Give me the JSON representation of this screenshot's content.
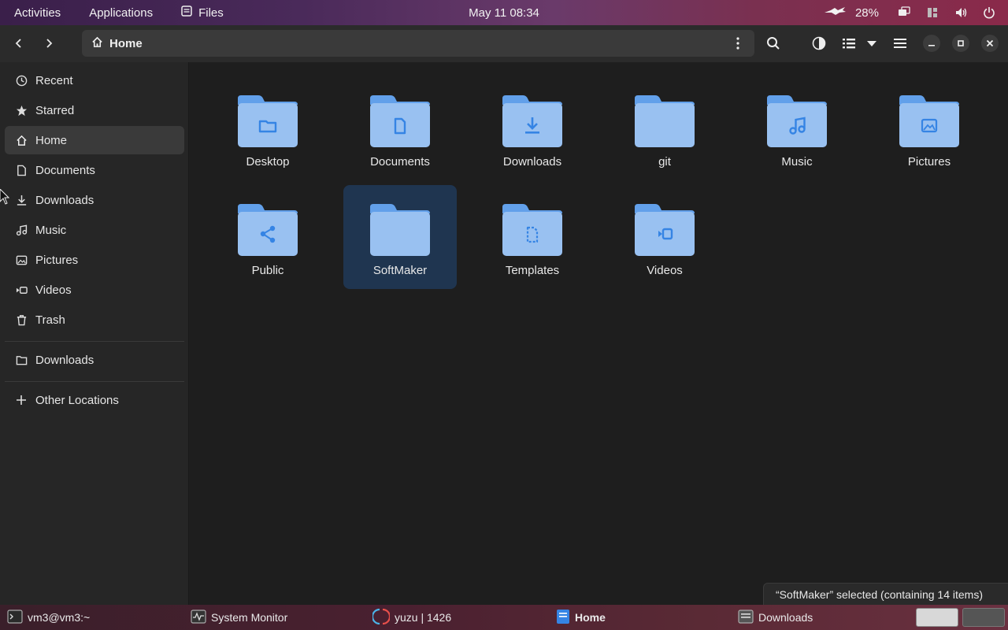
{
  "topbar": {
    "activities": "Activities",
    "applications": "Applications",
    "files": "Files",
    "clock": "May 11  08:34",
    "battery": "28%"
  },
  "header": {
    "path_label": "Home"
  },
  "sidebar": {
    "items": [
      {
        "label": "Recent",
        "icon": "clock-icon"
      },
      {
        "label": "Starred",
        "icon": "star-icon"
      },
      {
        "label": "Home",
        "icon": "home-icon"
      },
      {
        "label": "Documents",
        "icon": "document-icon"
      },
      {
        "label": "Downloads",
        "icon": "download-icon"
      },
      {
        "label": "Music",
        "icon": "music-icon"
      },
      {
        "label": "Pictures",
        "icon": "picture-icon"
      },
      {
        "label": "Videos",
        "icon": "video-icon"
      },
      {
        "label": "Trash",
        "icon": "trash-icon"
      }
    ],
    "bookmarks": [
      {
        "label": "Downloads",
        "icon": "folder-icon"
      }
    ],
    "other_locations": "Other Locations"
  },
  "folders": [
    {
      "name": "Desktop",
      "icon": "desktop-emblem"
    },
    {
      "name": "Documents",
      "icon": "document-emblem"
    },
    {
      "name": "Downloads",
      "icon": "download-emblem"
    },
    {
      "name": "git",
      "icon": "none"
    },
    {
      "name": "Music",
      "icon": "music-emblem"
    },
    {
      "name": "Pictures",
      "icon": "picture-emblem"
    },
    {
      "name": "Public",
      "icon": "share-emblem"
    },
    {
      "name": "SoftMaker",
      "icon": "none"
    },
    {
      "name": "Templates",
      "icon": "template-emblem"
    },
    {
      "name": "Videos",
      "icon": "video-emblem"
    }
  ],
  "status": "“SoftMaker” selected  (containing 14 items)",
  "taskbar": {
    "tasks": [
      {
        "label": "vm3@vm3:~"
      },
      {
        "label": "System Monitor"
      },
      {
        "label": "yuzu | 1426"
      },
      {
        "label": "Home"
      },
      {
        "label": "Downloads"
      }
    ]
  },
  "colors": {
    "folder_body": "#99c1f1",
    "folder_tab": "#62a0ea",
    "folder_emblem": "#3584e4",
    "selection": "#1f3550"
  }
}
